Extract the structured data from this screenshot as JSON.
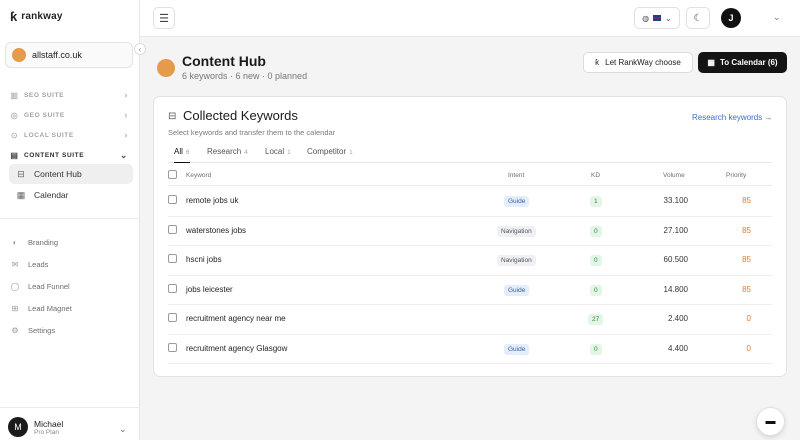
{
  "brand": {
    "logo_mark": "ƙ",
    "name": "rankway"
  },
  "site": {
    "domain": "allstaff.co.uk",
    "color": "#e59a4c"
  },
  "collapse_icon": "‹",
  "sidebar": {
    "suites": [
      {
        "label": "SEO SUITE",
        "icon": "seo-chart-icon"
      },
      {
        "label": "GEO SUITE",
        "icon": "geo-globe-icon"
      },
      {
        "label": "LOCAL SUITE",
        "icon": "local-pin-icon"
      },
      {
        "label": "CONTENT SUITE",
        "icon": "content-doc-icon"
      }
    ],
    "content_items": [
      {
        "label": "Content Hub",
        "icon": "inbox-icon",
        "selected": true
      },
      {
        "label": "Calendar",
        "icon": "calendar-icon"
      }
    ],
    "extras": [
      {
        "label": "Branding",
        "icon": "palette-icon"
      },
      {
        "label": "Leads",
        "icon": "mail-icon"
      },
      {
        "label": "Lead Funnel",
        "icon": "chat-icon"
      },
      {
        "label": "Lead Magnet",
        "icon": "gift-icon"
      },
      {
        "label": "Settings",
        "icon": "gear-icon"
      }
    ],
    "user": {
      "initial": "M",
      "name": "Michael",
      "plan": "Pro Plan"
    }
  },
  "topbar": {
    "avatar_initial": "J",
    "language": "en-gb"
  },
  "header": {
    "title": "Content Hub",
    "subtitle": "6 keywords · 6 new · 0 planned",
    "choose_label": "Let RankWay choose",
    "calendar_label": "To Calendar (6)"
  },
  "card": {
    "title": "Collected Keywords",
    "subtitle": "Select keywords and transfer them to the calendar",
    "research_link": "Research keywords →",
    "tabs": [
      {
        "label": "All",
        "count": "6",
        "active": true
      },
      {
        "label": "Research",
        "count": "4"
      },
      {
        "label": "Local",
        "count": "1"
      },
      {
        "label": "Competitor",
        "count": "1"
      }
    ],
    "columns": {
      "keyword": "Keyword",
      "intent": "Intent",
      "kd": "KD",
      "volume": "Volume",
      "priority": "Priority"
    },
    "rows": [
      {
        "keyword": "remote jobs uk",
        "intent": "Guide",
        "kd": "1",
        "volume": "33.100",
        "priority": "85"
      },
      {
        "keyword": "waterstones jobs",
        "intent": "Navigation",
        "kd": "0",
        "volume": "27.100",
        "priority": "85"
      },
      {
        "keyword": "hscni jobs",
        "intent": "Navigation",
        "kd": "0",
        "volume": "60.500",
        "priority": "85"
      },
      {
        "keyword": "jobs leicester",
        "intent": "Guide",
        "kd": "0",
        "volume": "14.800",
        "priority": "85"
      },
      {
        "keyword": "recruitment agency near me",
        "intent": "",
        "kd": "27",
        "volume": "2.400",
        "priority": "0"
      },
      {
        "keyword": "recruitment agency Glasgow",
        "intent": "Guide",
        "kd": "0",
        "volume": "4.400",
        "priority": "0"
      }
    ]
  },
  "colors": {
    "accent": "#e59a4c",
    "link": "#3b6fd4",
    "priority": "#e07a2b",
    "kd_green": "#2e8b3e"
  }
}
